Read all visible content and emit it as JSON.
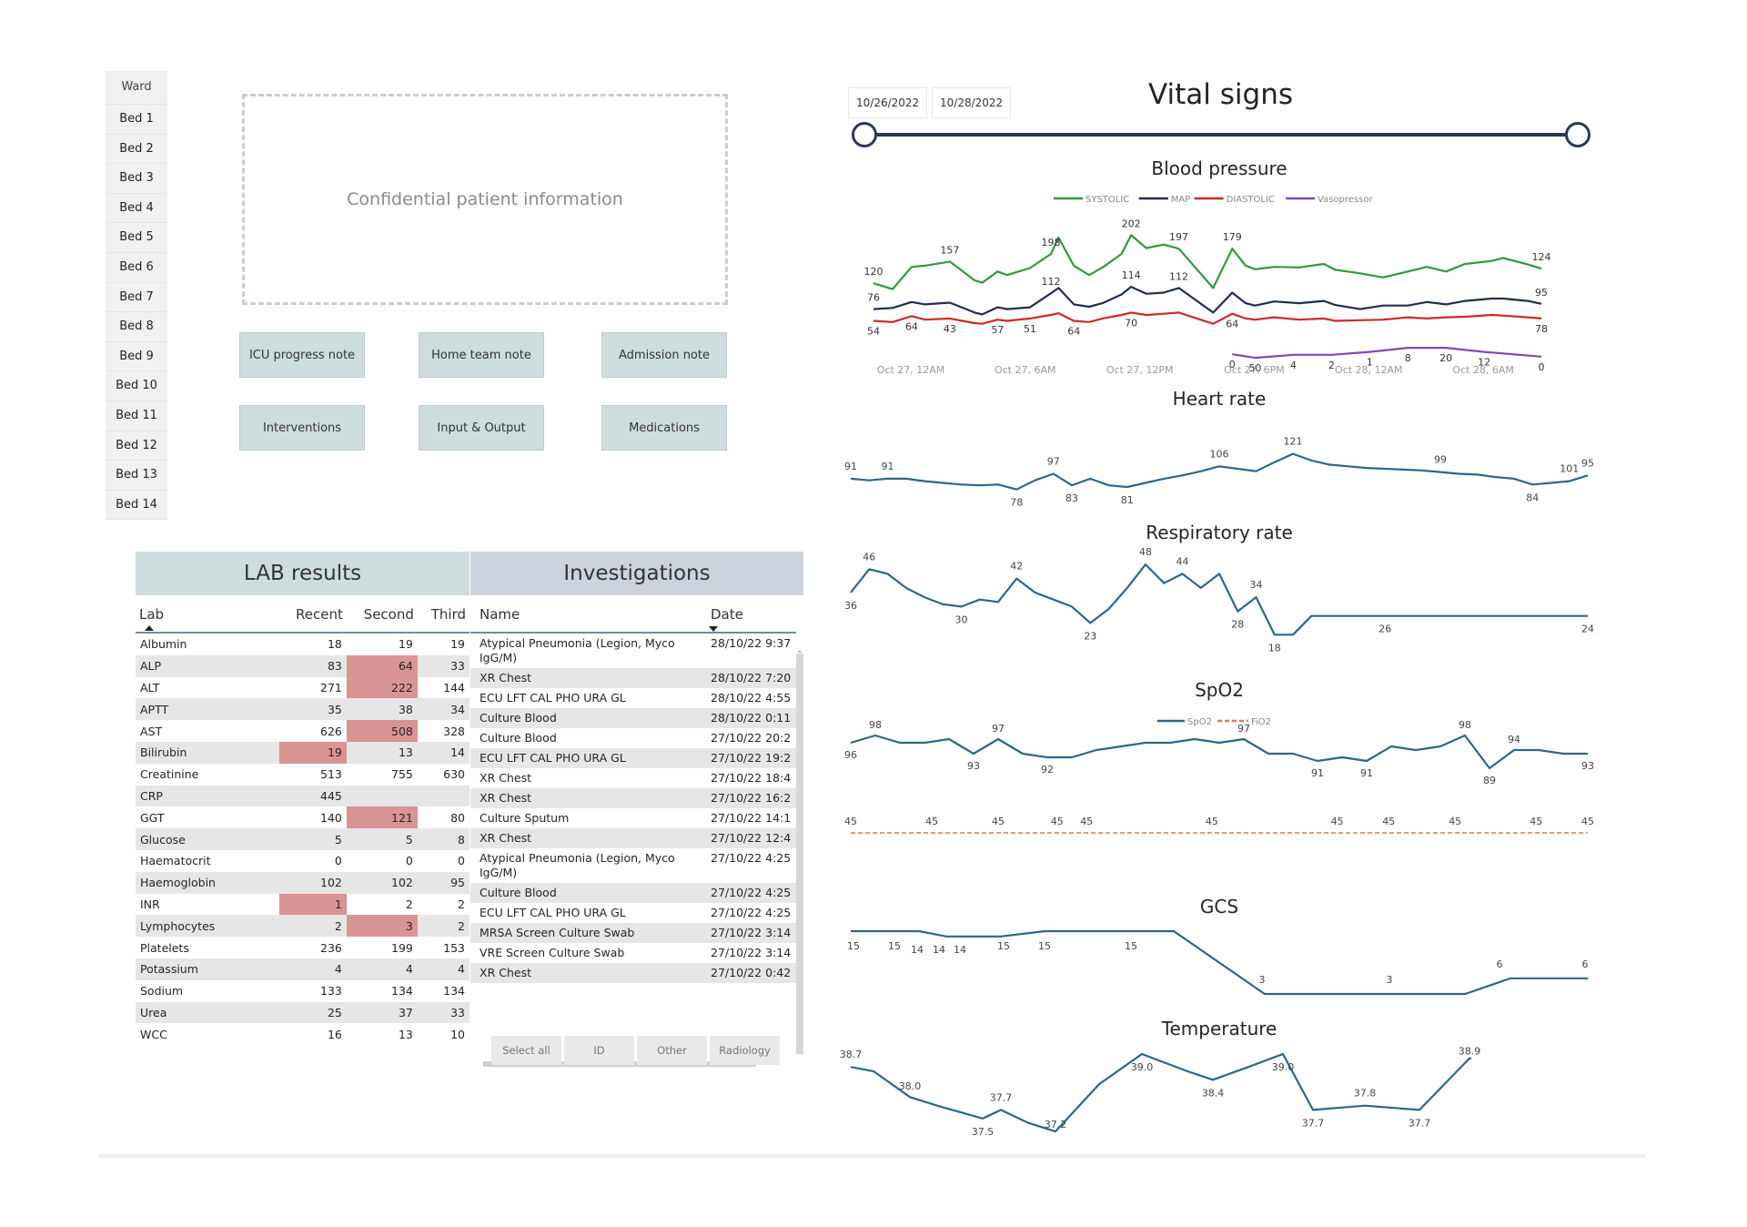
{
  "ward": {
    "header": "Ward",
    "beds": [
      "Bed 1",
      "Bed 2",
      "Bed 3",
      "Bed 4",
      "Bed 5",
      "Bed 6",
      "Bed 7",
      "Bed 8",
      "Bed 9",
      "Bed 10",
      "Bed 11",
      "Bed 12",
      "Bed 13",
      "Bed 14"
    ]
  },
  "patient": {
    "placeholder_text": "Confidential patient information"
  },
  "nav_buttons": [
    "ICU progress note",
    "Home team note",
    "Admission note",
    "Interventions",
    "Input & Output",
    "Medications"
  ],
  "lab": {
    "title": "LAB results",
    "columns": [
      "Lab",
      "Recent",
      "Second",
      "Third"
    ],
    "sort": "Lab ascending",
    "highlight_color": "#d99494",
    "rows": [
      {
        "lab": "Albumin",
        "recent": "18",
        "second": "19",
        "third": "19",
        "flag": ""
      },
      {
        "lab": "ALP",
        "recent": "83",
        "second": "64",
        "third": "33",
        "flag": "second"
      },
      {
        "lab": "ALT",
        "recent": "271",
        "second": "222",
        "third": "144",
        "flag": "second"
      },
      {
        "lab": "APTT",
        "recent": "35",
        "second": "38",
        "third": "34",
        "flag": ""
      },
      {
        "lab": "AST",
        "recent": "626",
        "second": "508",
        "third": "328",
        "flag": "second"
      },
      {
        "lab": "Bilirubin",
        "recent": "19",
        "second": "13",
        "third": "14",
        "flag": "recent"
      },
      {
        "lab": "Creatinine",
        "recent": "513",
        "second": "755",
        "third": "630",
        "flag": ""
      },
      {
        "lab": "CRP",
        "recent": "445",
        "second": "",
        "third": "",
        "flag": ""
      },
      {
        "lab": "GGT",
        "recent": "140",
        "second": "121",
        "third": "80",
        "flag": "second"
      },
      {
        "lab": "Glucose",
        "recent": "5",
        "second": "5",
        "third": "8",
        "flag": ""
      },
      {
        "lab": "Haematocrit",
        "recent": "0",
        "second": "0",
        "third": "0",
        "flag": ""
      },
      {
        "lab": "Haemoglobin",
        "recent": "102",
        "second": "102",
        "third": "95",
        "flag": ""
      },
      {
        "lab": "INR",
        "recent": "1",
        "second": "2",
        "third": "2",
        "flag": "recent"
      },
      {
        "lab": "Lymphocytes",
        "recent": "2",
        "second": "3",
        "third": "2",
        "flag": "second"
      },
      {
        "lab": "Platelets",
        "recent": "236",
        "second": "199",
        "third": "153",
        "flag": ""
      },
      {
        "lab": "Potassium",
        "recent": "4",
        "second": "4",
        "third": "4",
        "flag": ""
      },
      {
        "lab": "Sodium",
        "recent": "133",
        "second": "134",
        "third": "134",
        "flag": ""
      },
      {
        "lab": "Urea",
        "recent": "25",
        "second": "37",
        "third": "33",
        "flag": ""
      },
      {
        "lab": "WCC",
        "recent": "16",
        "second": "13",
        "third": "10",
        "flag": ""
      }
    ]
  },
  "investigations": {
    "title": "Investigations",
    "columns": [
      "Name",
      "Date"
    ],
    "sort": "Date descending",
    "rows": [
      {
        "name": "Atypical Pneumonia (Legion, Myco IgG/M)",
        "date": "28/10/22 9:37"
      },
      {
        "name": "XR Chest",
        "date": "28/10/22 7:20"
      },
      {
        "name": "ECU LFT CAL PHO URA GL",
        "date": "28/10/22 4:55"
      },
      {
        "name": "Culture Blood",
        "date": "28/10/22 0:11"
      },
      {
        "name": "Culture Blood",
        "date": "27/10/22 20:2"
      },
      {
        "name": "ECU LFT CAL PHO URA GL",
        "date": "27/10/22 19:2"
      },
      {
        "name": "XR Chest",
        "date": "27/10/22 18:4"
      },
      {
        "name": "XR Chest",
        "date": "27/10/22 16:2"
      },
      {
        "name": "Culture Sputum",
        "date": "27/10/22 14:1"
      },
      {
        "name": "XR Chest",
        "date": "27/10/22 12:4"
      },
      {
        "name": "Atypical Pneumonia (Legion, Myco IgG/M)",
        "date": "27/10/22 4:25"
      },
      {
        "name": "Culture Blood",
        "date": "27/10/22 4:25"
      },
      {
        "name": "ECU LFT CAL PHO URA GL",
        "date": "27/10/22 4:25"
      },
      {
        "name": "MRSA Screen Culture Swab",
        "date": "27/10/22 3:14"
      },
      {
        "name": "VRE Screen Culture Swab",
        "date": "27/10/22 3:14"
      },
      {
        "name": "XR Chest",
        "date": "27/10/22 0:42"
      }
    ],
    "filters": [
      "Select all",
      "ID",
      "Other",
      "Radiology"
    ]
  },
  "vitals": {
    "title": "Vital signs",
    "date_start": "10/26/2022",
    "date_end": "10/28/2022",
    "slider_range": [
      0,
      1
    ]
  },
  "colors": {
    "systolic": "#2e9a3e",
    "map": "#1f2d50",
    "diastolic": "#cc2a2a",
    "vasopressor": "#7e49b8",
    "vital_line": "#2c6884",
    "fio2": "#e0775a"
  },
  "chart_data": [
    {
      "type": "line",
      "title": "Blood pressure",
      "legend": [
        "SYSTOLIC",
        "MAP",
        "DIASTOLIC",
        "Vasopressor"
      ],
      "legend_position": "top-center",
      "x_ticks": [
        "Oct 27, 12AM",
        "Oct 27, 6AM",
        "Oct 27, 12PM",
        "Oct 27, 6PM",
        "Oct 28, 12AM",
        "Oct 28, 6AM"
      ],
      "x_range_hours": [
        -1,
        35
      ],
      "ylim": [
        -10,
        215
      ],
      "series": [
        {
          "name": "SYSTOLIC",
          "x": [
            -1,
            0,
            1,
            1.7,
            3,
            4.3,
            4.7,
            5.5,
            6,
            7.2,
            8.3,
            8.7,
            9.5,
            10.3,
            11,
            12,
            12.5,
            13.3,
            14.2,
            15,
            16.8,
            17.8,
            18.5,
            19,
            20,
            21.3,
            22.6,
            23.2,
            24.5,
            25.7,
            27,
            28,
            29,
            30,
            31.4,
            32,
            33.3,
            34
          ],
          "y": [
            120,
            110,
            148,
            150,
            157,
            125,
            121,
            140,
            134,
            146,
            170,
            198,
            150,
            134,
            147,
            170,
            202,
            180,
            186,
            179,
            112,
            179,
            150,
            144,
            148,
            147,
            153,
            143,
            137,
            130,
            140,
            148,
            140,
            153,
            158,
            163,
            152,
            145
          ],
          "labels": {
            "0": "120",
            "4": "157",
            "10": "198",
            "16": "202",
            "19": "197",
            "21": "179",
            "37": "124"
          }
        },
        {
          "name": "MAP",
          "x": [
            -1,
            0,
            1,
            1.7,
            3,
            4.3,
            4.7,
            5.5,
            6,
            7.2,
            8.3,
            8.7,
            9.5,
            10.3,
            11,
            12,
            12.5,
            13.3,
            14.2,
            15,
            16.8,
            17.8,
            18.5,
            19,
            20,
            21.3,
            22.6,
            23.2,
            24.5,
            25.7,
            27,
            28,
            29,
            30,
            31.4,
            32,
            33.3,
            34
          ],
          "y": [
            76,
            78,
            88,
            84,
            87,
            70,
            67,
            79,
            76,
            79,
            103,
            112,
            84,
            80,
            86,
            101,
            114,
            102,
            104,
            112,
            70,
            104,
            86,
            82,
            89,
            86,
            90,
            83,
            76,
            82,
            82,
            88,
            84,
            90,
            94,
            94,
            90,
            85
          ],
          "labels": {
            "0": "76",
            "10": "112",
            "16": "114",
            "19": "112",
            "37": "95"
          }
        },
        {
          "name": "DIASTOLIC",
          "x": [
            -1,
            0,
            1,
            1.7,
            3,
            4.3,
            4.7,
            5.5,
            6,
            7.2,
            8.3,
            8.7,
            9.5,
            10.3,
            11,
            12,
            12.5,
            13.3,
            14.2,
            15,
            16.8,
            17.8,
            18.5,
            19,
            20,
            21.3,
            22.6,
            23.2,
            24.5,
            25.7,
            27,
            28,
            29,
            30,
            31.4,
            32,
            33.3,
            34
          ],
          "y": [
            56,
            54,
            64,
            58,
            60,
            52,
            51,
            58,
            56,
            60,
            66,
            69,
            56,
            54,
            60,
            66,
            70,
            66,
            68,
            70,
            51,
            68,
            60,
            58,
            62,
            58,
            60,
            56,
            57,
            58,
            62,
            60,
            62,
            63,
            66,
            65,
            62,
            60
          ],
          "labels": {
            "0": "54",
            "2": "64",
            "4": "43",
            "7": "57",
            "9": "51",
            "12": "64",
            "16": "70",
            "21": "64",
            "37": "78"
          }
        },
        {
          "name": "Vasopressor",
          "x": [
            17.8,
            19,
            21,
            23,
            25,
            27,
            29,
            31,
            34
          ],
          "y": [
            -1,
            -7,
            -2,
            -2,
            3,
            10,
            10,
            3,
            -5
          ],
          "labels": {
            "0": "0",
            "1": "50",
            "2": "4",
            "3": "2",
            "4": "1",
            "5": "8",
            "6": "20",
            "7": "12",
            "8": "0"
          }
        }
      ]
    },
    {
      "type": "line",
      "title": "Heart rate",
      "x": [
        0,
        1,
        2,
        3,
        4,
        5,
        6,
        7,
        8,
        9,
        10,
        11,
        12,
        13,
        14,
        15,
        16,
        17,
        18,
        19,
        20,
        21,
        22,
        23,
        24,
        25,
        26,
        27,
        28,
        29,
        30,
        31,
        32,
        33,
        34,
        35,
        36,
        37,
        38,
        39,
        40
      ],
      "y": [
        91,
        89,
        91,
        91,
        88,
        86,
        84,
        83,
        84,
        78,
        89,
        97,
        83,
        91,
        83,
        81,
        86,
        91,
        95,
        100,
        106,
        103,
        100,
        111,
        121,
        113,
        108,
        106,
        104,
        103,
        102,
        101,
        99,
        97,
        96,
        93,
        91,
        84,
        86,
        88,
        95
      ],
      "point_labels": {
        "0": "91",
        "2": "91",
        "9": "78",
        "11": "97",
        "12": "83",
        "15": "81",
        "20": "106",
        "24": "121",
        "32": "99",
        "37": "84",
        "39": "101",
        "40": "95"
      }
    },
    {
      "type": "line",
      "title": "Respiratory rate",
      "x": [
        0,
        1,
        2,
        3,
        4,
        5,
        6,
        7,
        8,
        9,
        10,
        11,
        12,
        13,
        14,
        15,
        16,
        17,
        18,
        19,
        20,
        21,
        22,
        23,
        24,
        25,
        26,
        27,
        28,
        29,
        30,
        31,
        32,
        33,
        34,
        35,
        36,
        37,
        38,
        39,
        40
      ],
      "y": [
        36,
        46,
        44,
        38,
        34,
        31,
        30,
        33,
        32,
        42,
        36,
        33,
        30,
        23,
        29,
        38,
        48,
        40,
        44,
        38,
        44,
        28,
        34,
        18,
        18,
        26,
        26,
        26,
        26,
        26,
        26,
        26,
        26,
        26,
        26,
        26,
        26,
        26,
        26,
        26,
        26
      ],
      "point_labels": {
        "0": "36",
        "1": "46",
        "6": "30",
        "9": "42",
        "13": "23",
        "16": "48",
        "18": "44",
        "21": "28",
        "22": "34",
        "23": "18",
        "29": "26",
        "40": "24"
      }
    },
    {
      "type": "line",
      "title": "SpO2",
      "legend": [
        "SpO2",
        "FiO2"
      ],
      "legend_position": "top-center",
      "series": [
        {
          "name": "SpO2",
          "x": [
            0,
            1,
            2,
            3,
            4,
            5,
            6,
            7,
            8,
            9,
            10,
            11,
            12,
            13,
            14,
            15,
            16,
            17,
            18,
            19,
            20,
            21,
            22,
            23,
            24,
            25,
            26,
            27,
            28,
            29,
            30
          ],
          "y": [
            96,
            98,
            96,
            96,
            97,
            93,
            97,
            93,
            92,
            92,
            94,
            95,
            96,
            96,
            97,
            96,
            97,
            93,
            93,
            91,
            92,
            91,
            95,
            94,
            95,
            98,
            89,
            94,
            94,
            93,
            93
          ],
          "point_labels": {
            "0": "96",
            "1": "98",
            "5": "93",
            "6": "97",
            "8": "92",
            "16": "97",
            "19": "91",
            "21": "91",
            "25": "98",
            "26": "89",
            "27": "94",
            "30": "93"
          }
        },
        {
          "name": "FiO2",
          "style": "dashed",
          "value": 45,
          "label_x": [
            0,
            0.11,
            0.2,
            0.28,
            0.32,
            0.49,
            0.66,
            0.73,
            0.82,
            0.93,
            1.0
          ],
          "label": "45"
        }
      ]
    },
    {
      "type": "line",
      "title": "GCS",
      "x": [
        0,
        1,
        2,
        3,
        4,
        5,
        6,
        7,
        8,
        9,
        10,
        11,
        12,
        13
      ],
      "y": [
        15,
        15,
        14,
        14,
        14,
        15,
        15,
        15,
        15,
        3,
        3,
        3,
        6,
        6
      ],
      "point_labels": {
        "0": "15",
        "1": "15",
        "2": "14",
        "3": "14",
        "4": "14",
        "5": "15",
        "6": "15",
        "7": "15",
        "9": "3",
        "11": "3",
        "12": "6",
        "13": "6"
      }
    },
    {
      "type": "line",
      "title": "Temperature",
      "x": [
        0,
        1,
        2,
        3,
        4,
        5,
        6,
        7,
        8,
        9,
        10,
        11,
        12,
        13,
        14,
        15,
        16,
        17,
        18
      ],
      "y": [
        38.7,
        38.6,
        38.0,
        37.8,
        37.5,
        37.7,
        37.4,
        37.2,
        38.3,
        39.0,
        38.6,
        38.4,
        38.7,
        39.0,
        37.7,
        37.8,
        37.7,
        38.9,
        38.9
      ],
      "point_labels": {
        "0": "38.7",
        "2": "38.0",
        "4": "37.5",
        "5": "37.7",
        "7": "37.2",
        "9": "39.0",
        "11": "38.4",
        "13": "39.0",
        "14": "37.7",
        "15": "37.8",
        "16": "37.7",
        "17": "38.9"
      }
    }
  ]
}
